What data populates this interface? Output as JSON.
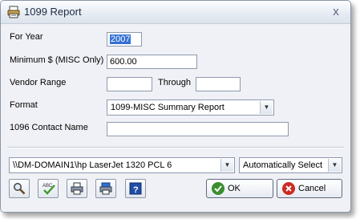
{
  "window": {
    "title": "1099 Report",
    "close_glyph": "x"
  },
  "form": {
    "for_year_label": "For Year",
    "for_year_value": "2007",
    "minimum_label": "Minimum $ (MISC Only)",
    "minimum_value": "600.00",
    "vendor_range_label": "Vendor Range",
    "vendor_from_value": "",
    "through_label": "Through",
    "vendor_to_value": "",
    "format_label": "Format",
    "format_value": "1099-MISC Summary Report",
    "contact_label": "1096 Contact Name",
    "contact_value": ""
  },
  "printer": {
    "printer_value": "\\\\DM-DOMAIN1\\hp LaserJet 1320 PCL 6",
    "tray_value": "Automatically Select"
  },
  "toolbar": {
    "icons": [
      "preview-magnifier-icon",
      "spell-check-icon",
      "print-icon",
      "print-setup-icon",
      "help-icon"
    ]
  },
  "actions": {
    "ok_label": "OK",
    "cancel_label": "Cancel",
    "ok_color": "#3a8d2f",
    "cancel_color": "#cc2a22"
  }
}
